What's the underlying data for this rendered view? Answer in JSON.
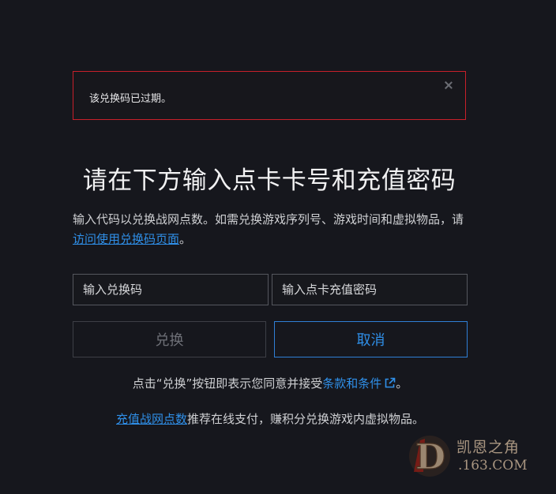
{
  "alert": {
    "message": "该兑换码已过期。",
    "close_icon": "close-icon"
  },
  "heading": {
    "title": "请在下方输入点卡卡号和充值密码"
  },
  "description": {
    "text": "输入代码以兑换战网点数。如需兑换游戏序列号、游戏时间和虚拟物品，请",
    "link_text": "访问使用兑换码页面",
    "suffix": "。"
  },
  "form": {
    "code_placeholder": "输入兑换码",
    "password_placeholder": "输入点卡充值密码",
    "redeem_label": "兑换",
    "cancel_label": "取消"
  },
  "terms": {
    "prefix": "点击“兑换”按钮即表示您同意并接受",
    "link_text": "条款和条件",
    "external_icon": "external-link-icon",
    "suffix": "。"
  },
  "recharge": {
    "link_text": "充值战网点数",
    "text": "推荐在线支付，赚积分兑换游戏内虚拟物品。"
  },
  "watermark": {
    "logo_letter": "D",
    "line1": "凯恩之角",
    "line2": ".163.COM"
  },
  "colors": {
    "background": "#16171d",
    "alert_border": "#c8202a",
    "link": "#2f8fe8",
    "cancel_border": "#2f7fd6"
  }
}
